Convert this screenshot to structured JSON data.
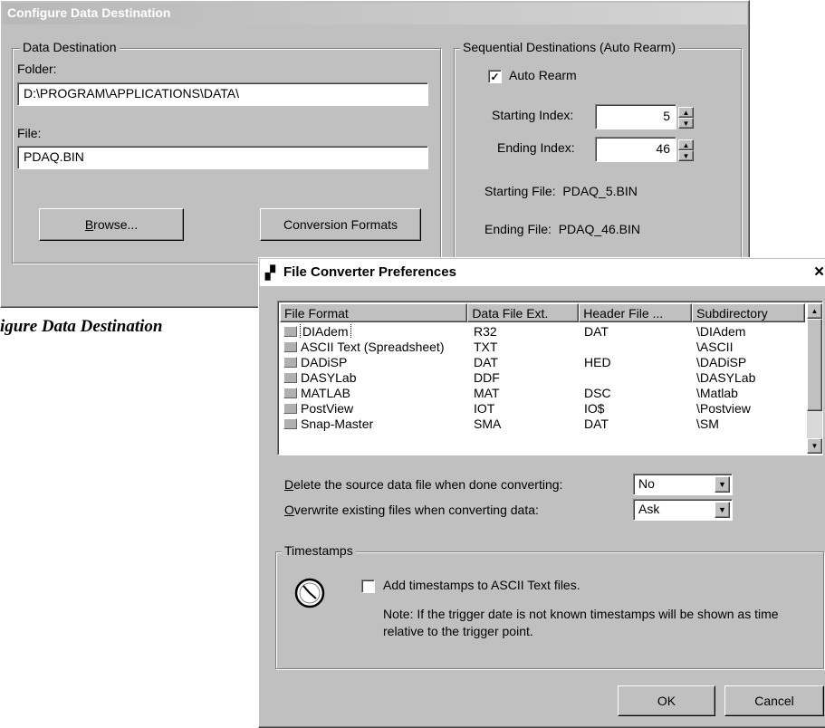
{
  "dialog1": {
    "title": "Configure Data Destination",
    "caption": "igure Data Destination",
    "data_destination": {
      "legend": "Data Destination",
      "folder_label": "Folder:",
      "folder_value": "D:\\PROGRAM\\APPLICATIONS\\DATA\\",
      "file_label": "File:",
      "file_value": "PDAQ.BIN",
      "browse_label": "rowse...",
      "browse_mnemonic": "B",
      "conversion_label": "Conversion Formats"
    },
    "sequential": {
      "legend": "Sequential Destinations (Auto Rearm)",
      "auto_rearm_label": "Auto Rearm",
      "auto_rearm_checked": true,
      "starting_index_label": "Starting Index:",
      "starting_index_value": "5",
      "ending_index_label": "Ending Index:",
      "ending_index_value": "46",
      "starting_file_text": "Starting File:  PDAQ_5.BIN",
      "ending_file_text": "Ending File:  PDAQ_46.BIN"
    }
  },
  "dialog2": {
    "title": "File Converter Preferences",
    "close_glyph": "×",
    "columns": [
      "File Format",
      "Data File Ext.",
      "Header File ...",
      "Subdirectory"
    ],
    "rows": [
      {
        "format": "DIAdem",
        "ext": "R32",
        "header": "DAT",
        "subdir": "\\DIAdem",
        "selected": true
      },
      {
        "format": "ASCII Text (Spreadsheet)",
        "ext": "TXT",
        "header": "",
        "subdir": "\\ASCII",
        "selected": false
      },
      {
        "format": "DADiSP",
        "ext": "DAT",
        "header": "HED",
        "subdir": "\\DADiSP",
        "selected": false
      },
      {
        "format": "DASYLab",
        "ext": "DDF",
        "header": "",
        "subdir": "\\DASYLab",
        "selected": false
      },
      {
        "format": "MATLAB",
        "ext": "MAT",
        "header": "DSC",
        "subdir": "\\Matlab",
        "selected": false
      },
      {
        "format": "PostView",
        "ext": "IOT",
        "header": "IO$",
        "subdir": "\\Postview",
        "selected": false
      },
      {
        "format": "Snap-Master",
        "ext": "SMA",
        "header": "DAT",
        "subdir": "\\SM",
        "selected": false
      }
    ],
    "delete_mnemonic": "D",
    "delete_label": "elete the source data file when done converting:",
    "delete_value": "No",
    "overwrite_mnemonic": "O",
    "overwrite_label": "verwrite existing files when converting data:",
    "overwrite_value": "Ask",
    "timestamps": {
      "legend": "Timestamps",
      "checkbox_label": "Add timestamps to ASCII Text files.",
      "checked": false,
      "note": "Note: If the trigger date is not known timestamps will be shown as time relative to the trigger point."
    },
    "ok_label": "OK",
    "cancel_label": "Cancel"
  }
}
